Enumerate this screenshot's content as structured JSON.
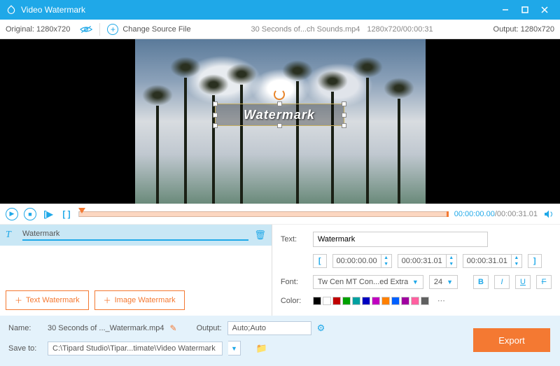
{
  "titlebar": {
    "title": "Video Watermark"
  },
  "toolbar": {
    "original_label": "Original:  1280x720",
    "change_source": "Change Source File",
    "file_name": "30 Seconds of...ch Sounds.mp4",
    "file_info": "1280x720/00:00:31",
    "output_label": "Output:  1280x720"
  },
  "watermark": {
    "text": "Watermark"
  },
  "timeline": {
    "current": "00:00:00.00",
    "total": "/00:00:31.01"
  },
  "wm_item": {
    "label": "Watermark"
  },
  "buttons": {
    "text_wm": "Text Watermark",
    "img_wm": "Image Watermark"
  },
  "props": {
    "text_label": "Text:",
    "text_value": "Watermark",
    "time_start": "00:00:00.00",
    "time_end": "00:00:31.01",
    "time_dur": "00:00:31.01",
    "font_label": "Font:",
    "font_name": "Tw Cen MT Con...ed Extra Bold",
    "font_size": "24",
    "color_label": "Color:"
  },
  "colors": [
    "#000000",
    "#ffffff",
    "#c00000",
    "#00a000",
    "#00a0a0",
    "#0000c0",
    "#c000c0",
    "#ff8000",
    "#0060ff",
    "#a000a0",
    "#ff60a0",
    "#606060"
  ],
  "bottom": {
    "name_label": "Name:",
    "name_value": "30 Seconds of ..._Watermark.mp4",
    "output_label": "Output:",
    "output_value": "Auto;Auto",
    "save_label": "Save to:",
    "save_value": "C:\\Tipard Studio\\Tipar...timate\\Video Watermark",
    "export": "Export"
  }
}
